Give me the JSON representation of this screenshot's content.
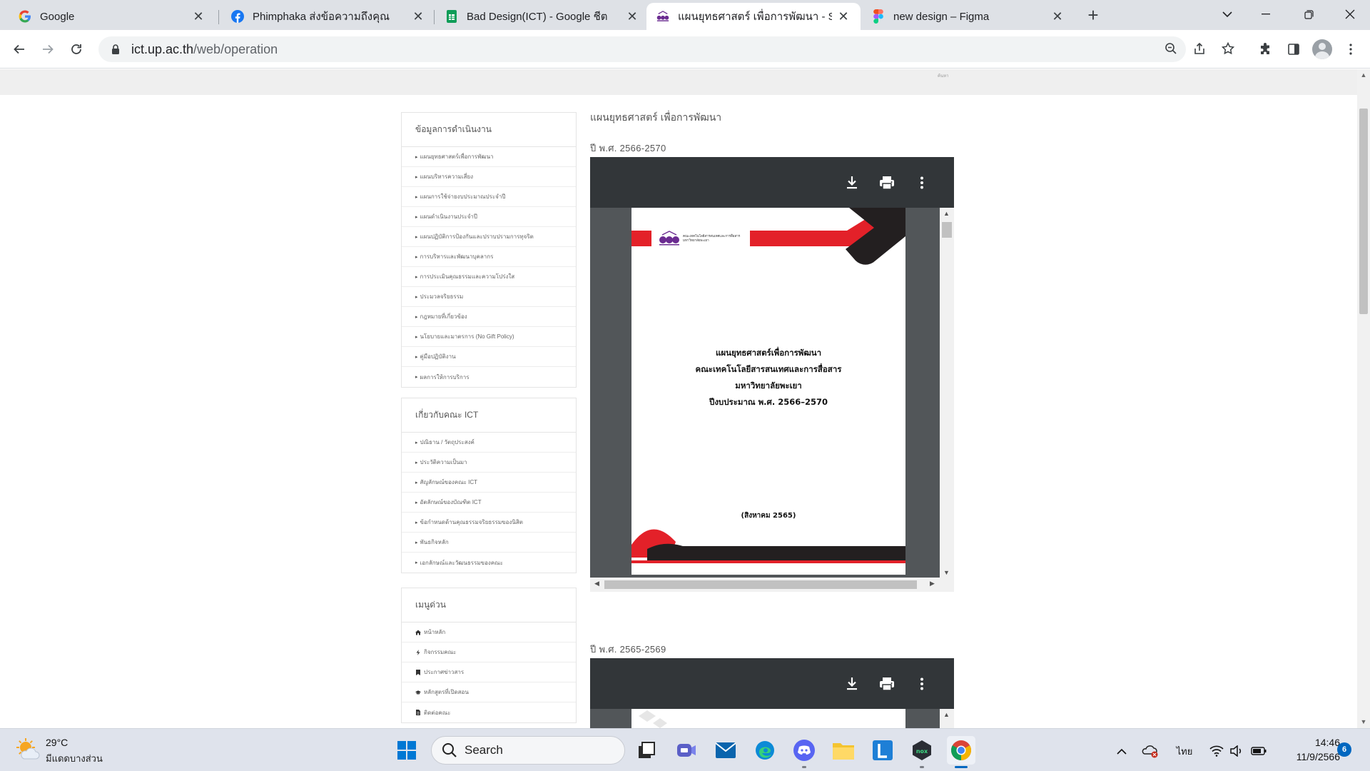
{
  "browser": {
    "tabs": [
      {
        "title": "Google",
        "icon": "google-icon",
        "active": false
      },
      {
        "title": "Phimphaka ส่งข้อความถึงคุณ",
        "icon": "facebook-icon",
        "active": false
      },
      {
        "title": "Bad Design(ICT) - Google ชีต",
        "icon": "sheets-icon",
        "active": false
      },
      {
        "title": "แผนยุทธศาสตร์ เพื่อการพัฒนา - Scho",
        "icon": "university-icon",
        "active": true
      },
      {
        "title": "new design – Figma",
        "icon": "figma-icon",
        "active": false
      }
    ],
    "url": {
      "host": "ict.up.ac.th",
      "path": "/web/operation"
    }
  },
  "site": {
    "header_tiny_text": "ค้นหา",
    "sidebar": {
      "sections": [
        {
          "heading": "ข้อมูลการดำเนินงาน",
          "items": [
            "แผนยุทธศาสตร์เพื่อการพัฒนา",
            "แผนบริหารความเสี่ยง",
            "แผนการใช้จ่ายงบประมาณประจำปี",
            "แผนดำเนินงานประจำปี",
            "แผนปฏิบัติการป้องกันและปราบปรามการทุจริต",
            "การบริหารและพัฒนาบุคลากร",
            "การประเมินคุณธรรมและความโปร่งใส",
            "ประมวลจริยธรรม",
            "กฎหมายที่เกี่ยวข้อง",
            "นโยบายและมาตรการ (No Gift Policy)",
            "คู่มือปฏิบัติงาน",
            "ผลการให้การบริการ"
          ]
        },
        {
          "heading": "เกี่ยวกับคณะ ICT",
          "items": [
            "ปณิธาน / วัตถุประสงค์",
            "ประวัติความเป็นมา",
            "สัญลักษณ์ของคณะ ICT",
            "อัตลักษณ์ของบัณฑิต ICT",
            "ข้อกำหนดด้านคุณธรรมจริยธรรมของนิสิต",
            "พันธกิจหลัก",
            "เอกลักษณ์และวัฒนธรรมของคณะ"
          ]
        },
        {
          "heading": "เมนูด่วน",
          "items": [
            {
              "icon": "home-icon",
              "label": "หน้าหลัก"
            },
            {
              "icon": "bolt-icon",
              "label": "กิจกรรมคณะ"
            },
            {
              "icon": "bookmark-icon",
              "label": "ประกาศข่าวสาร"
            },
            {
              "icon": "graduation-cap-icon",
              "label": "หลักสูตรที่เปิดสอน"
            },
            {
              "icon": "document-icon",
              "label": "ติดต่อคณะ"
            }
          ]
        }
      ]
    },
    "main": {
      "title": "แผนยุทธศาสตร์ เพื่อการพัฒนา",
      "documents": [
        {
          "year_label": "ปี พ.ศ. 2566-2570",
          "page": {
            "logo_text_line1": "คณะเทคโนโลยีสารสนเทศและการสื่อสาร",
            "logo_text_line2": "มหาวิทยาลัยพะเยา",
            "title_lines": [
              "แผนยุทธศาสตร์เพื่อการพัฒนา",
              "คณะเทคโนโลยีสารสนเทศและการสื่อสาร",
              "มหาวิทยาลัยพะเยา",
              "ปีงบประมาณ พ.ศ. 2566–2570"
            ],
            "date": "(สิงหาคม 2565)"
          }
        },
        {
          "year_label": "ปี พ.ศ. 2565-2569"
        }
      ]
    }
  },
  "taskbar": {
    "weather": {
      "temp": "29°C",
      "desc": "มีแดดบางส่วน"
    },
    "search_label": "Search",
    "lang": "ไทย",
    "time": "14:46",
    "date": "11/9/2566",
    "notifications": "6"
  },
  "colors": {
    "brand_red": "#e32129",
    "brand_dark": "#231f20",
    "brand_purple": "#6b2c91",
    "pdf_toolbar": "#323639",
    "pdf_background": "#525659"
  }
}
